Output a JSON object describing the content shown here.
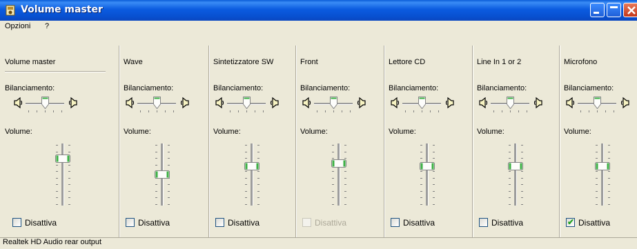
{
  "window": {
    "title": "Volume master"
  },
  "menu": {
    "items": [
      "Opzioni",
      "?"
    ]
  },
  "labels": {
    "balance": "Bilanciamento:",
    "volume": "Volume:",
    "mute": "Disattiva"
  },
  "channels": [
    {
      "name": "Volume master",
      "volume": 0.8,
      "balance": 0.5,
      "muted": false,
      "disabled": false
    },
    {
      "name": "Wave",
      "volume": 0.5,
      "balance": 0.5,
      "muted": false,
      "disabled": false
    },
    {
      "name": "Sintetizzatore SW",
      "volume": 0.66,
      "balance": 0.5,
      "muted": false,
      "disabled": false
    },
    {
      "name": "Front",
      "volume": 0.71,
      "balance": 0.5,
      "muted": false,
      "disabled": true
    },
    {
      "name": "Lettore CD",
      "volume": 0.66,
      "balance": 0.5,
      "muted": false,
      "disabled": false
    },
    {
      "name": "Line In 1 or 2",
      "volume": 0.66,
      "balance": 0.5,
      "muted": false,
      "disabled": false
    },
    {
      "name": "Microfono",
      "volume": 0.66,
      "balance": 0.5,
      "muted": true,
      "disabled": false
    }
  ],
  "status": {
    "text": "Realtek HD Audio rear output"
  },
  "colors": {
    "titlebar": "#0a5cd8",
    "thumb_green": "#3cb043",
    "window_bg": "#ece9d8"
  }
}
